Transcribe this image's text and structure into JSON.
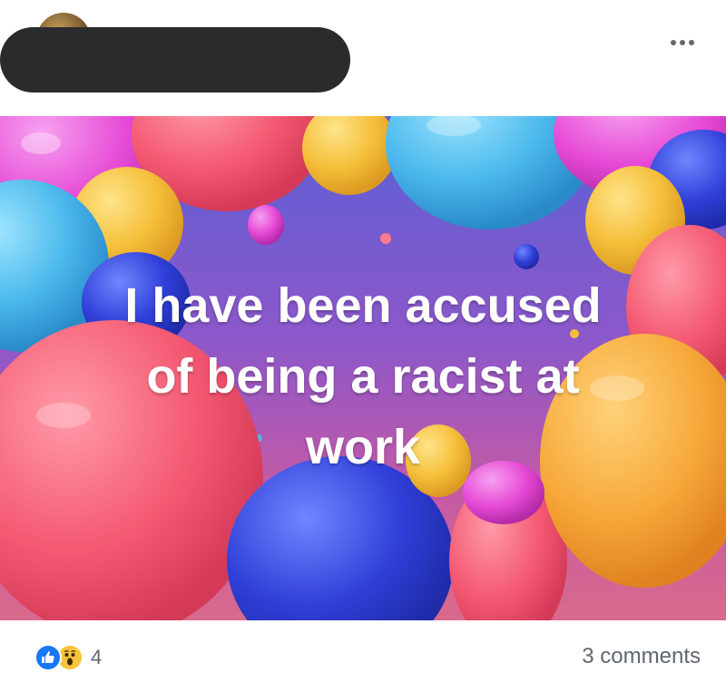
{
  "post": {
    "menu_icon": "more-horizontal-icon",
    "image": {
      "caption_lines": [
        "I have been accused",
        "of being a racist at",
        "work"
      ]
    },
    "footer": {
      "reactions": [
        "like-icon",
        "wow-icon"
      ],
      "reaction_count": "4",
      "comments_text": "3 comments"
    }
  }
}
